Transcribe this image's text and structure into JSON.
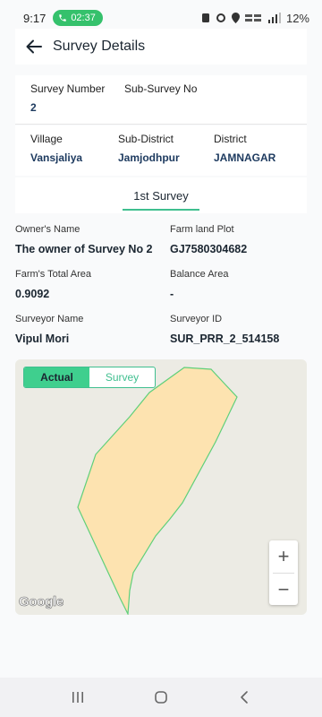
{
  "status": {
    "time": "9:17",
    "call_time": "02:37",
    "battery": "12%"
  },
  "header": {
    "title": "Survey Details",
    "back_icon": "arrow-left-icon"
  },
  "survey": {
    "number_label": "Survey Number",
    "number_value": "2",
    "sub_label": "Sub-Survey No",
    "sub_value": ""
  },
  "location": {
    "village_label": "Village",
    "village_value": "Vansjaliya",
    "subdistrict_label": "Sub-District",
    "subdistrict_value": "Jamjodhpur",
    "district_label": "District",
    "district_value": "JAMNAGAR"
  },
  "tabs": {
    "items": [
      {
        "label": "1st Survey",
        "active": true
      }
    ]
  },
  "details": {
    "owner_label": "Owner's Name",
    "owner_value": "The owner of Survey No 2",
    "plot_label": "Farm land Plot",
    "plot_value": "GJ7580304682",
    "total_area_label": "Farm's Total Area",
    "total_area_value": "0.9092",
    "balance_label": "Balance Area",
    "balance_value": "-",
    "surveyor_label": "Surveyor Name",
    "surveyor_value": "Vipul Mori",
    "surveyor_id_label": "Surveyor ID",
    "surveyor_id_value": "SUR_PRR_2_514158"
  },
  "map": {
    "toggle_actual": "Actual",
    "toggle_survey": "Survey",
    "active_toggle": "Actual",
    "zoom_in": "+",
    "zoom_out": "−",
    "attribution": "Google",
    "parcel_fill": "#fde3b0",
    "parcel_stroke": "#5fd07a"
  },
  "colors": {
    "accent": "#3fbf8f",
    "call_pill": "#35c16c"
  }
}
